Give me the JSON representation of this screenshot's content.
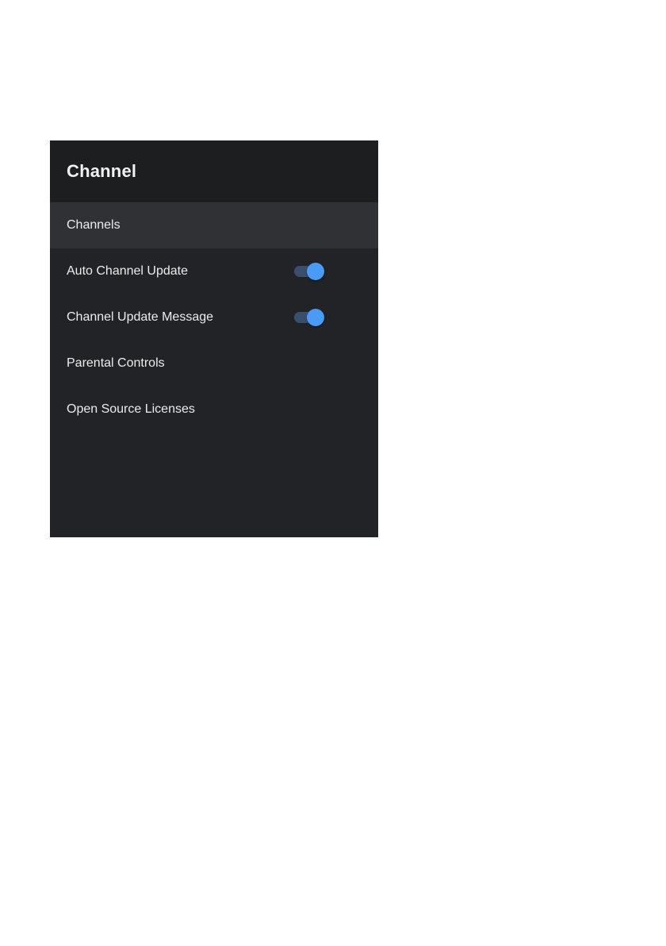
{
  "header": {
    "title": "Channel"
  },
  "menu": {
    "items": [
      {
        "label": "Channels",
        "selected": true,
        "toggle": null
      },
      {
        "label": "Auto Channel Update",
        "selected": false,
        "toggle": "on"
      },
      {
        "label": "Channel Update Message",
        "selected": false,
        "toggle": "on"
      },
      {
        "label": "Parental Controls",
        "selected": false,
        "toggle": null
      },
      {
        "label": "Open Source Licenses",
        "selected": false,
        "toggle": null
      }
    ]
  },
  "colors": {
    "toggle_thumb_on": "#4a9bf5",
    "toggle_track_on": "#3a4f6b"
  }
}
